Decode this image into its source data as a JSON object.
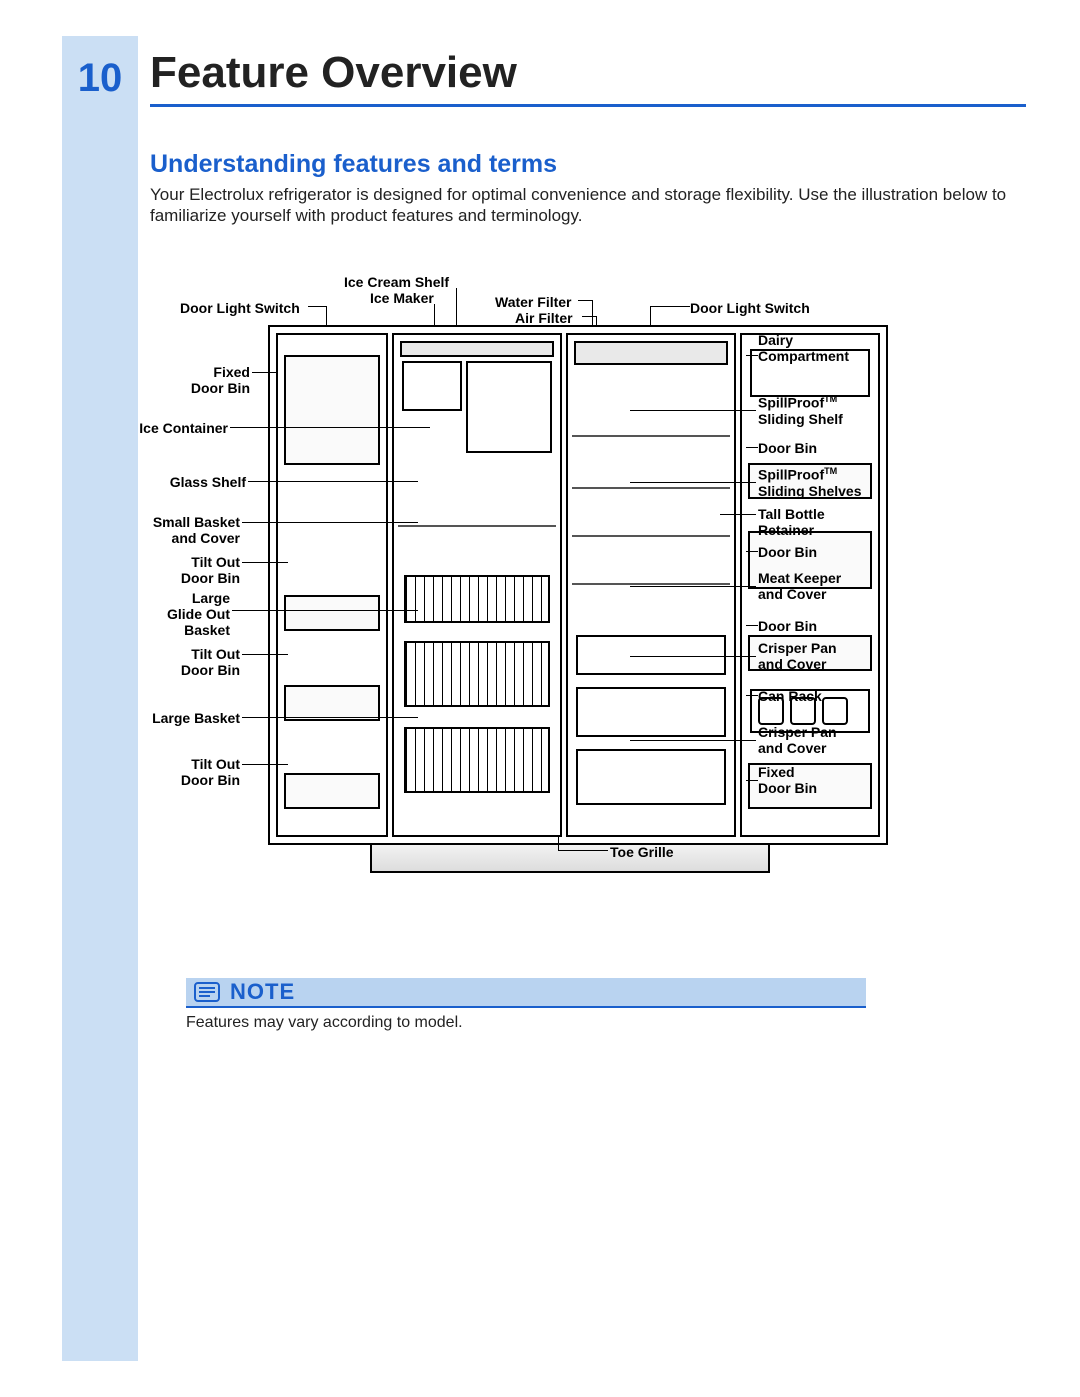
{
  "page": {
    "number": "10",
    "title": "Feature Overview",
    "subheading": "Understanding features and terms",
    "intro": "Your Electrolux refrigerator is designed for optimal convenience and storage flexibility. Use the illustration below to familiarize yourself with product features and terminology."
  },
  "labels": {
    "top": {
      "ice_cream_shelf": "Ice Cream Shelf",
      "ice_maker": "Ice Maker",
      "door_light_switch_l": "Door Light Switch",
      "water_filter": "Water Filter",
      "air_filter": "Air Filter",
      "door_light_switch_r": "Door Light Switch"
    },
    "left": {
      "fixed_door_bin": "Fixed\nDoor Bin",
      "ice_container": "Ice Container",
      "glass_shelf": "Glass Shelf",
      "small_basket_and_cover": "Small Basket\nand Cover",
      "tilt_out_door_bin_1": "Tilt Out\nDoor Bin",
      "large_glide_out_basket": "Large\nGlide Out\nBasket",
      "tilt_out_door_bin_2": "Tilt Out\nDoor Bin",
      "large_basket": "Large Basket",
      "tilt_out_door_bin_3": "Tilt Out\nDoor Bin"
    },
    "right": {
      "dairy_compartment": "Dairy\nCompartment",
      "spillproof_sliding_shelf": "SpillProof™\nSliding Shelf",
      "door_bin_1": "Door Bin",
      "spillproof_sliding_shelves": "SpillProof™\nSliding Shelves",
      "tall_bottle_retainer": "Tall Bottle\nRetainer",
      "door_bin_2": "Door Bin",
      "meat_keeper_and_cover": "Meat Keeper\nand Cover",
      "door_bin_3": "Door Bin",
      "crisper_pan_and_cover_1": "Crisper Pan\nand Cover",
      "can_rack": "Can Rack",
      "crisper_pan_and_cover_2": "Crisper Pan\nand Cover",
      "fixed_door_bin": "Fixed\nDoor Bin"
    },
    "bottom": {
      "toe_grille": "Toe Grille"
    }
  },
  "note": {
    "heading": "NOTE",
    "text": "Features may vary according to model."
  }
}
